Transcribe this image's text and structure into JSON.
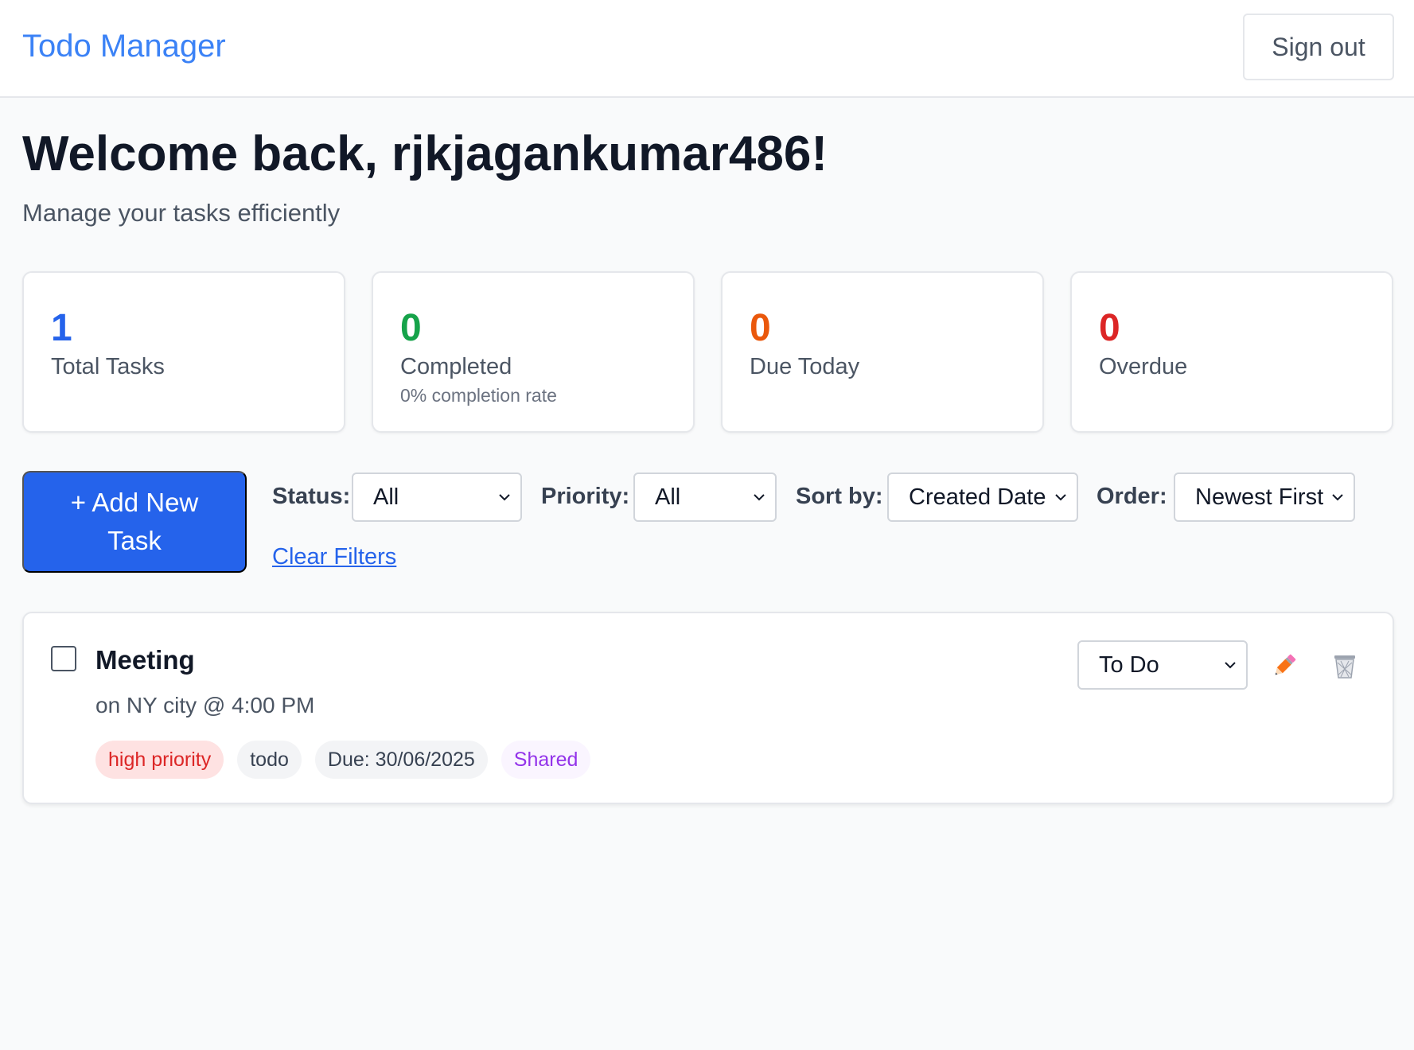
{
  "header": {
    "app_title": "Todo Manager",
    "signout_label": "Sign out"
  },
  "welcome": {
    "title": "Welcome back, rjkjagankumar486!",
    "subtitle": "Manage your tasks efficiently"
  },
  "stats": [
    {
      "value": "1",
      "label": "Total Tasks",
      "extra": "",
      "color": "#2563eb"
    },
    {
      "value": "0",
      "label": "Completed",
      "extra": "0% completion rate",
      "color": "#16a34a"
    },
    {
      "value": "0",
      "label": "Due Today",
      "extra": "",
      "color": "#ea580c"
    },
    {
      "value": "0",
      "label": "Overdue",
      "extra": "",
      "color": "#dc2626"
    }
  ],
  "actions": {
    "add_task_label": "+ Add New Task"
  },
  "filters": {
    "status_label": "Status:",
    "status_value": "All",
    "priority_label": "Priority:",
    "priority_value": "All",
    "sort_label": "Sort by:",
    "sort_value": "Created Date",
    "order_label": "Order:",
    "order_value": "Newest First",
    "clear_label": "Clear Filters"
  },
  "tasks": [
    {
      "title": "Meeting",
      "description": "on NY city @ 4:00 PM",
      "priority_tag": "high priority",
      "status_tag": "todo",
      "due_tag": "Due: 30/06/2025",
      "shared_tag": "Shared",
      "status_select": "To Do",
      "completed": false
    }
  ],
  "icons": {
    "edit": "pencil-icon",
    "delete": "trash-icon",
    "dropdown": "chevron-down-icon"
  },
  "colors": {
    "brand": "#3b82f6",
    "primary_button": "#2563eb",
    "link": "#2563eb"
  }
}
